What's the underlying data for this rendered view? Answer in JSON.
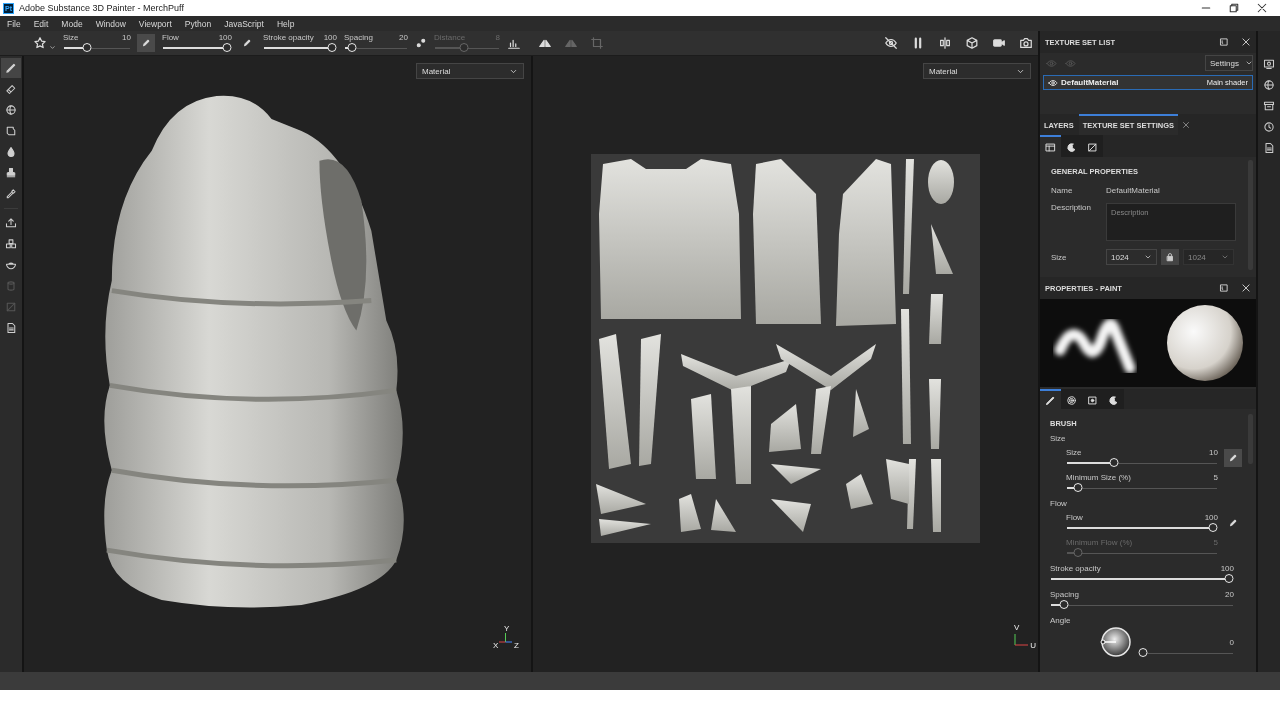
{
  "window": {
    "title": "Adobe Substance 3D Painter - MerchPuff",
    "app_icon_text": "Pt"
  },
  "menu": [
    "File",
    "Edit",
    "Mode",
    "Window",
    "Viewport",
    "Python",
    "JavaScript",
    "Help"
  ],
  "toolbar": {
    "sliders": [
      {
        "label": "Size",
        "value": "10",
        "level": 0.33,
        "disabled": false,
        "pen_pressure": true
      },
      {
        "label": "Flow",
        "value": "100",
        "level": 1,
        "disabled": false,
        "pen_pressure": false
      },
      {
        "label": "Stroke opacity",
        "value": "100",
        "level": 1,
        "disabled": false
      },
      {
        "label": "Spacing",
        "value": "20",
        "level": 0.05,
        "disabled": false
      },
      {
        "label": "Distance",
        "value": "8",
        "level": 0.45,
        "disabled": true
      }
    ]
  },
  "tools": [
    {
      "kind": "brush",
      "selected": true,
      "disabled": false
    },
    {
      "kind": "eraser",
      "selected": false,
      "disabled": false
    },
    {
      "kind": "sphere",
      "selected": false,
      "disabled": false
    },
    {
      "kind": "polygon",
      "selected": false,
      "disabled": false
    },
    {
      "kind": "drop",
      "selected": false,
      "disabled": false
    },
    {
      "kind": "stamp",
      "selected": false,
      "disabled": false
    },
    {
      "kind": "eyedropper",
      "selected": false,
      "disabled": false
    },
    {
      "kind": "tray",
      "selected": false,
      "disabled": false
    },
    {
      "kind": "cubes",
      "selected": false,
      "disabled": false
    },
    {
      "kind": "bowl",
      "selected": false,
      "disabled": false
    },
    {
      "kind": "cylinder",
      "selected": false,
      "disabled": true
    },
    {
      "kind": "square",
      "selected": false,
      "disabled": true
    },
    {
      "kind": "document",
      "selected": false,
      "disabled": false
    }
  ],
  "viewports": [
    {
      "kind": "model",
      "dropdown": "Material",
      "axes": [
        "Y",
        "X",
        "Z"
      ]
    },
    {
      "kind": "uv",
      "dropdown": "Material",
      "axes": [
        "V",
        "U"
      ]
    }
  ],
  "texture_set_list": {
    "title": "TEXTURE SET LIST",
    "dropdown": "Settings",
    "items": [
      {
        "name": "DefaultMaterial",
        "shader": "Main shader",
        "selected": true
      }
    ]
  },
  "tabs": [
    {
      "label": "LAYERS",
      "selected": false
    },
    {
      "label": "TEXTURE SET SETTINGS",
      "selected": true
    }
  ],
  "texture_set_settings": {
    "subtabs": [
      {
        "selected": true
      },
      {
        "selected": false
      },
      {
        "selected": false
      }
    ],
    "heading": "GENERAL PROPERTIES",
    "name_label": "Name",
    "name_value": "DefaultMaterial",
    "description_label": "Description",
    "description_placeholder": "Description",
    "size_label": "Size",
    "size_value": "1024",
    "linked_size": {
      "value": "1024",
      "disabled": true
    }
  },
  "properties_paint": {
    "title": "PROPERTIES - PAINT",
    "tabs": [
      {
        "selected": true
      },
      {
        "selected": false
      },
      {
        "selected": false
      },
      {
        "selected": false
      }
    ],
    "brush": {
      "heading": "BRUSH",
      "items": [
        {
          "kind": "group",
          "label": "Size",
          "children": [
            {
              "label": "Size",
              "value": "10",
              "level": 0.3,
              "disabled": false,
              "pen_pressure": true
            },
            {
              "label": "Minimum Size (%)",
              "value": "5",
              "level": 0.05,
              "disabled": false
            }
          ]
        },
        {
          "kind": "group",
          "label": "Flow",
          "children": [
            {
              "label": "Flow",
              "value": "100",
              "level": 1,
              "disabled": false,
              "pen_pressure": false
            },
            {
              "label": "Minimum Flow (%)",
              "value": "5",
              "level": 0.05,
              "disabled": true
            }
          ]
        },
        {
          "kind": "slider",
          "label": "Stroke opacity",
          "value": "100",
          "level": 1,
          "disabled": false
        },
        {
          "kind": "slider",
          "label": "Spacing",
          "value": "20",
          "level": 0.05,
          "disabled": false
        },
        {
          "kind": "angle",
          "label": "Angle",
          "value": "0",
          "level": 0
        }
      ]
    }
  }
}
